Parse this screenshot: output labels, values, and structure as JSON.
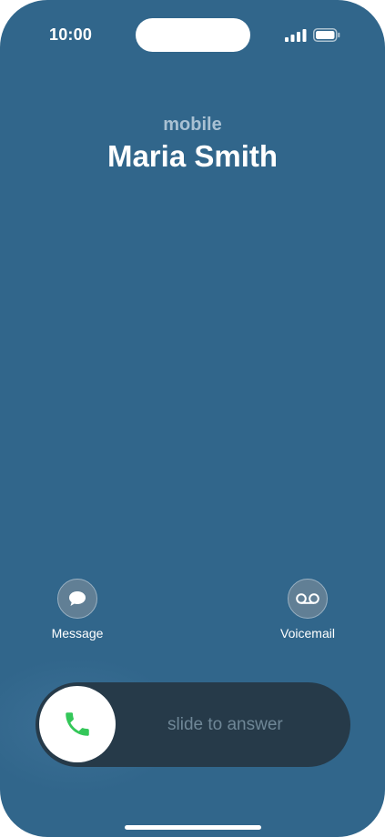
{
  "status_bar": {
    "time": "10:00",
    "signal_icon": "signal-bars-icon",
    "battery_icon": "battery-icon"
  },
  "caller": {
    "label": "mobile",
    "name": "Maria Smith"
  },
  "actions": {
    "message": {
      "label": "Message",
      "icon": "message-bubble-icon"
    },
    "voicemail": {
      "label": "Voicemail",
      "icon": "voicemail-icon"
    }
  },
  "answer_slider": {
    "text": "slide to answer",
    "icon": "phone-icon"
  },
  "colors": {
    "background": "#31668b",
    "slider_track": "#263a49",
    "accept_green": "#34c759"
  }
}
